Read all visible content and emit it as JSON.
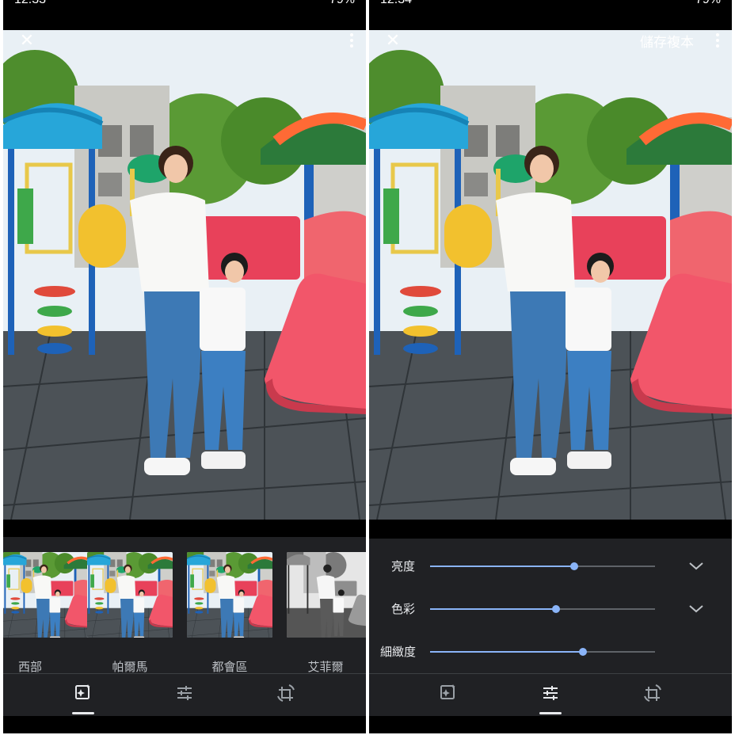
{
  "left": {
    "status": {
      "time": "12:33",
      "battery": "79%"
    },
    "photo_alt": "playground photo",
    "toolbar": {
      "close_icon": "close-icon",
      "more_icon": "more-vert-icon"
    },
    "filters": [
      {
        "label": "西部",
        "tone": "color"
      },
      {
        "label": "帕爾馬",
        "tone": "color"
      },
      {
        "label": "都會區",
        "tone": "color"
      },
      {
        "label": "艾菲爾",
        "tone": "mono"
      }
    ],
    "nav": {
      "active": "filters",
      "items": [
        "filters-icon",
        "adjust-icon",
        "crop-rotate-icon"
      ]
    }
  },
  "right": {
    "status": {
      "time": "12:34",
      "battery": "79%"
    },
    "toolbar": {
      "save_copy": "儲存複本",
      "close_icon": "close-icon",
      "more_icon": "more-vert-icon"
    },
    "adjustments": [
      {
        "label": "亮度",
        "value": 0.64,
        "expandable": true
      },
      {
        "label": "色彩",
        "value": 0.56,
        "expandable": true
      },
      {
        "label": "細緻度",
        "value": 0.68,
        "expandable": false
      }
    ],
    "nav": {
      "active": "adjust",
      "items": [
        "filters-icon",
        "adjust-icon",
        "crop-rotate-icon"
      ]
    }
  },
  "colors": {
    "accent": "#8ab4f8",
    "background": "#202124",
    "text": "#e8eaed"
  }
}
